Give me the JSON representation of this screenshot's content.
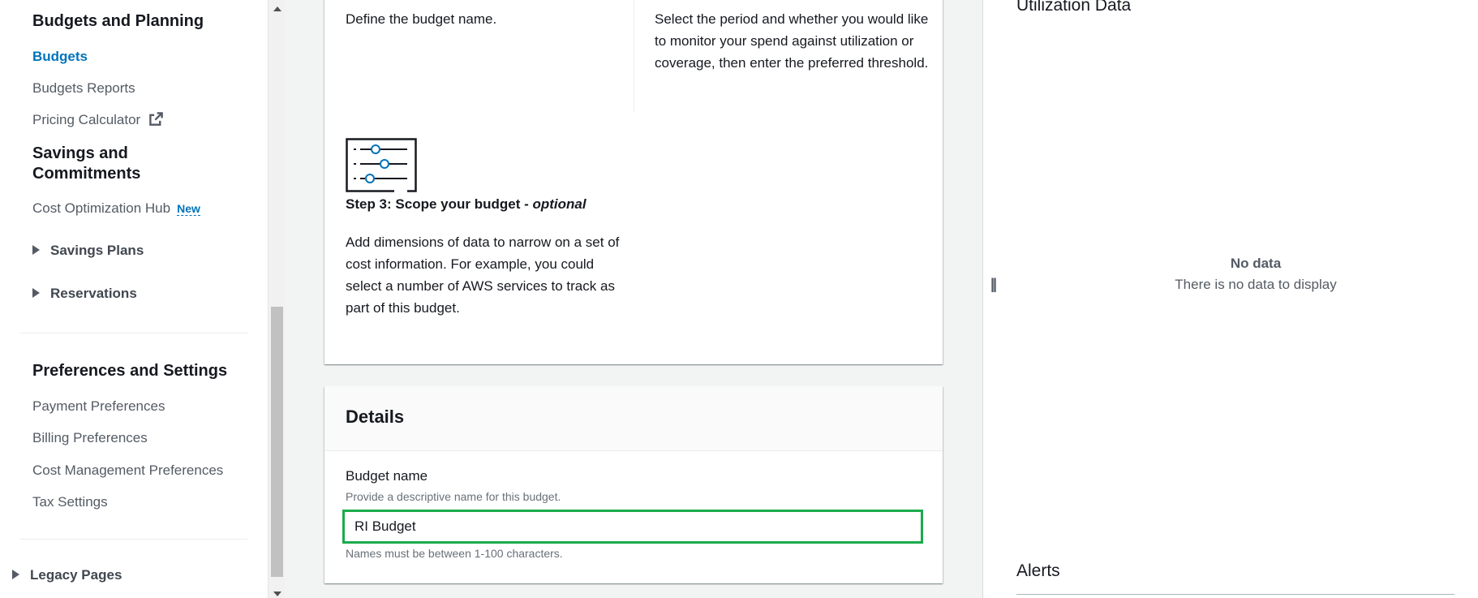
{
  "sidebar": {
    "budgets_planning_heading": "Budgets and Planning",
    "budgets": "Budgets",
    "budgets_reports": "Budgets Reports",
    "pricing_calculator": "Pricing Calculator",
    "savings_heading": "Savings and Commitments",
    "cost_optimization_hub": "Cost Optimization Hub",
    "new_badge": "New",
    "savings_plans": "Savings Plans",
    "reservations": "Reservations",
    "preferences_heading": "Preferences and Settings",
    "payment_preferences": "Payment Preferences",
    "billing_preferences": "Billing Preferences",
    "cost_management_preferences": "Cost Management Preferences",
    "tax_settings": "Tax Settings",
    "legacy_pages": "Legacy Pages"
  },
  "steps": {
    "step1_desc": "Define the budget name.",
    "step2_desc": "Select the period and whether you would like to monitor your spend against utilization or coverage, then enter the preferred threshold.",
    "step3_title_prefix": "Step 3: Scope your budget - ",
    "step3_title_optional": "optional",
    "step3_desc": "Add dimensions of data to narrow on a set of cost information. For example, you could select a number of AWS services to track as part of this budget."
  },
  "details": {
    "title": "Details",
    "budget_name_label": "Budget name",
    "budget_name_desc": "Provide a descriptive name for this budget.",
    "budget_name_value": "RI Budget",
    "budget_name_hint": "Names must be between 1-100 characters."
  },
  "split_panel": {
    "utilization_title": "Utilization Data",
    "no_data_title": "No data",
    "no_data_desc": "There is no data to display",
    "alerts_title": "Alerts"
  },
  "colors": {
    "link_active": "#0073bb",
    "input_focus": "#1aab4b"
  }
}
